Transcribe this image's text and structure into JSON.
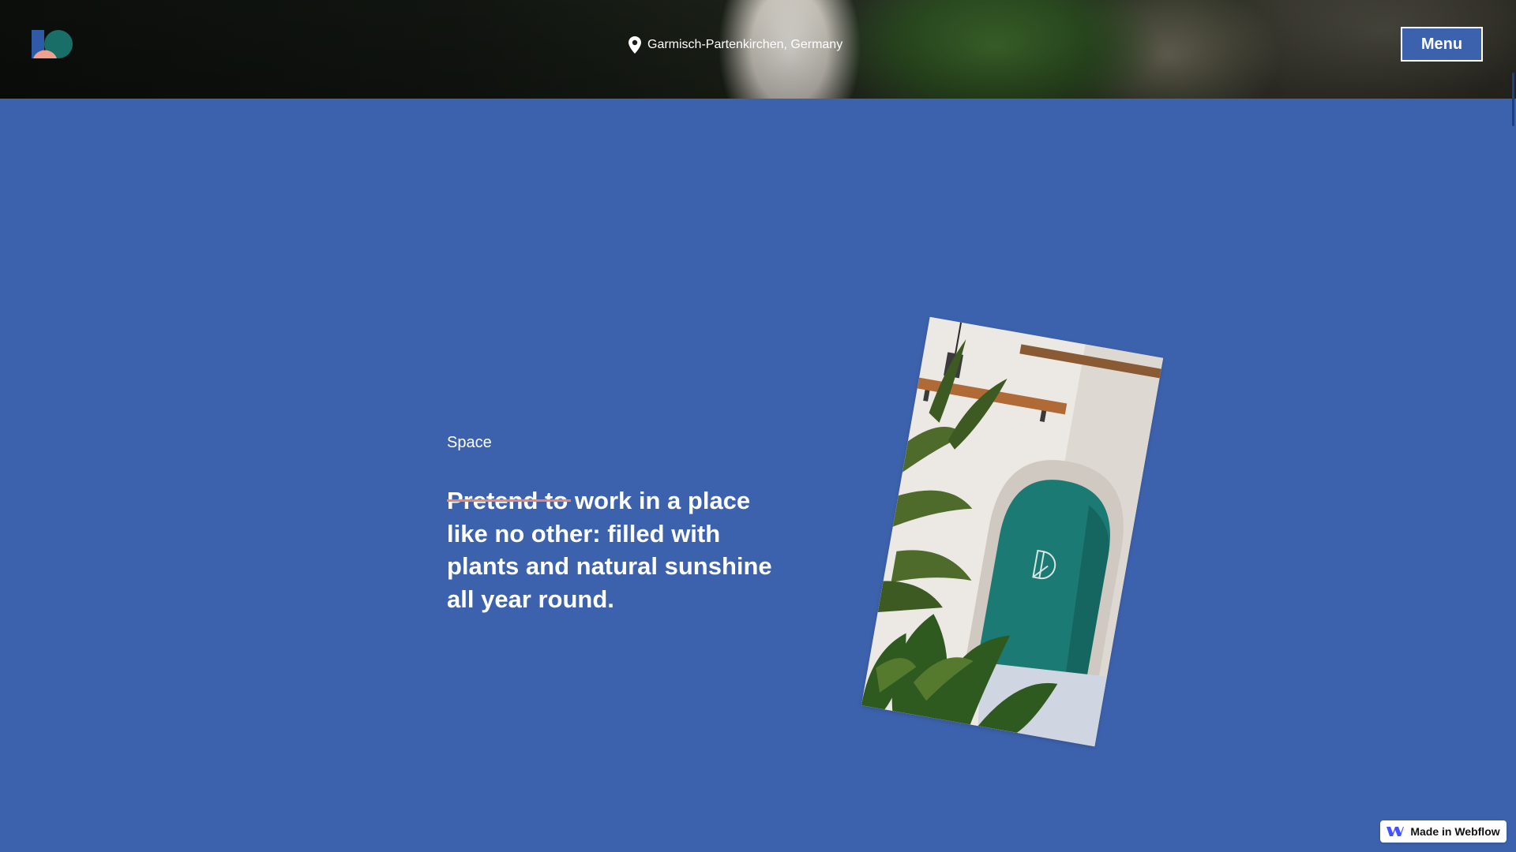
{
  "header": {
    "location_text": "Garmisch-Partenkirchen, Germany",
    "menu_label": "Menu"
  },
  "section": {
    "eyebrow": "Space",
    "headline_struck": "Pretend to",
    "headline_rest": " work in a place like no other: filled with plants and natural sunshine all year round."
  },
  "badge": {
    "label": "Made in Webflow"
  },
  "colors": {
    "page_background": "#3d62ad",
    "accent_strike": "#e9856e",
    "door_teal": "#1b7a73",
    "logo_blue": "#2e5aa8",
    "logo_salmon": "#f0a08e",
    "logo_teal": "#1a6e68"
  },
  "icons": {
    "logo": "brand-logo-icon",
    "location": "map-pin-icon",
    "badge": "webflow-logo-icon"
  }
}
